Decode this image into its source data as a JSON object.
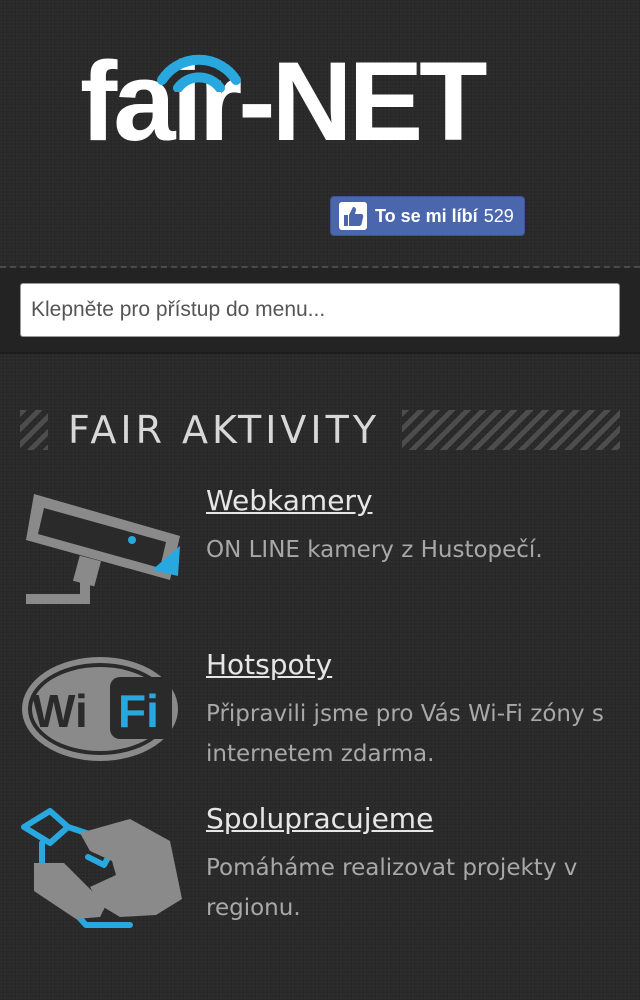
{
  "header": {
    "logo_text": "fair-NET",
    "fb_like": {
      "label": "To se mi líbí",
      "count": "529"
    }
  },
  "menu": {
    "placeholder": "Klepněte pro přístup do menu..."
  },
  "section": {
    "title": "FAIR AKTIVITY"
  },
  "items": [
    {
      "title": "Webkamery",
      "description": "ON LINE kamery z Hustopečí.",
      "icon": "camera-icon"
    },
    {
      "title": "Hotspoty",
      "description": "Připravili jsme pro Vás Wi-Fi zóny s internetem zdarma.",
      "icon": "wifi-badge-icon"
    },
    {
      "title": "Spolupracujeme",
      "description": "Pomáháme realizovat projekty v regionu.",
      "icon": "handshake-icon"
    }
  ],
  "colors": {
    "accent": "#29a8e0",
    "facebook": "#4a66ad",
    "background": "#2a2a2a"
  }
}
